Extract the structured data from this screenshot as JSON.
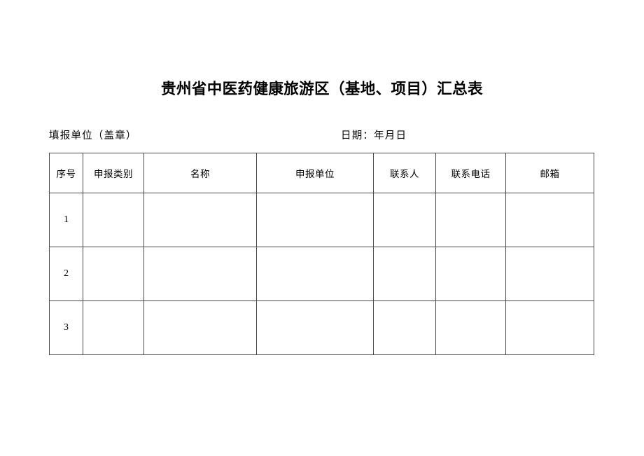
{
  "document": {
    "title": "贵州省中医药健康旅游区（基地、项目）汇总表",
    "subheader": {
      "filler_unit": "填报单位（盖章）",
      "date": "日期：年月日"
    }
  },
  "table": {
    "columns": [
      {
        "key": "index",
        "label": "序号"
      },
      {
        "key": "category",
        "label": "申报类别"
      },
      {
        "key": "name",
        "label": "名称"
      },
      {
        "key": "unit",
        "label": "申报单位"
      },
      {
        "key": "contact",
        "label": "联系人"
      },
      {
        "key": "phone",
        "label": "联系电话"
      },
      {
        "key": "email",
        "label": "邮箱"
      }
    ],
    "rows": [
      {
        "index": "1",
        "category": "",
        "name": "",
        "unit": "",
        "contact": "",
        "phone": "",
        "email": ""
      },
      {
        "index": "2",
        "category": "",
        "name": "",
        "unit": "",
        "contact": "",
        "phone": "",
        "email": ""
      },
      {
        "index": "3",
        "category": "",
        "name": "",
        "unit": "",
        "contact": "",
        "phone": "",
        "email": ""
      }
    ]
  },
  "colors": {
    "page_background": "#ffffff",
    "text": "#000000",
    "table_border": "#4a4a4a"
  }
}
